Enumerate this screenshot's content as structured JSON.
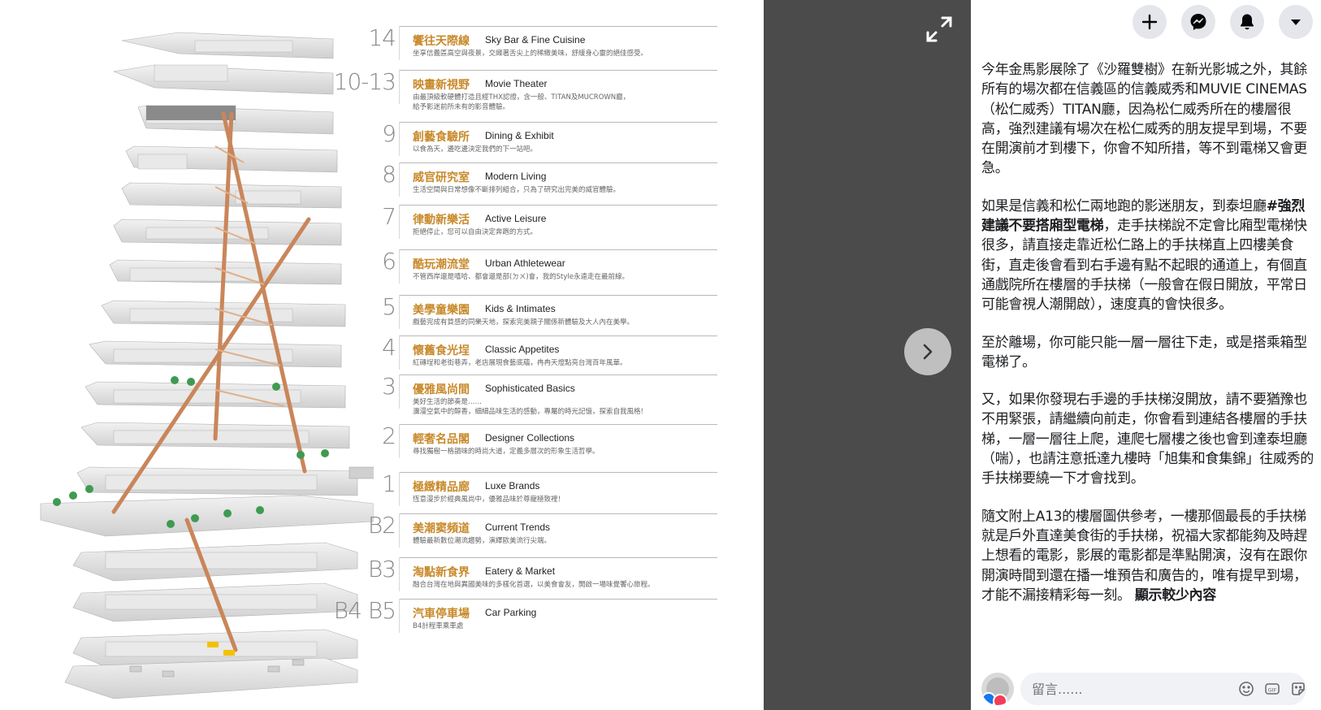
{
  "floors": [
    {
      "num": "14",
      "zh": "饗往天際線",
      "en": "Sky Bar & Fine Cuisine",
      "desc": "坐享信義區高空與夜景，交織著舌尖上的稀緻美味，舒緩身心靈的絕佳感受。"
    },
    {
      "num": "10-13",
      "zh": "映畫新視野",
      "en": "Movie Theater",
      "desc": "由最頂級軟硬體打造且經THX認證，含一般、TITAN及MUCROWN廳，\n給予影迷前所未有的影音體驗。"
    },
    {
      "num": "9",
      "zh": "創藝食驗所",
      "en": "Dining & Exhibit",
      "desc": "以食為天，邊吃邊決定我們的下一站吧。"
    },
    {
      "num": "8",
      "zh": "威官研究室",
      "en": "Modern Living",
      "desc": "生活空間與日常想像不斷排列組合，只為了研究出完美的威官體驗。"
    },
    {
      "num": "7",
      "zh": "律動新樂活",
      "en": "Active Leisure",
      "desc": "拒絕停止，您可以自由決定奔跑的方式。"
    },
    {
      "num": "6",
      "zh": "酷玩潮流堂",
      "en": "Urban Athletewear",
      "desc": "不管西岸還是嘻哈、都會還是部(ㄉㄨ)會，我的Style永遠走在最前線。"
    },
    {
      "num": "5",
      "zh": "美學童樂園",
      "en": "Kids & Intimates",
      "desc": "戲藝完成有質感的同樂天地，探索完美親子關係新體驗及大人內在美學。"
    },
    {
      "num": "4",
      "zh": "懷舊食光埕",
      "en": "Classic Appetites",
      "desc": "紅磚埕和老街巷弄，老店展現食藝底蘊，冉冉天燈點亮台灣百年風華。"
    },
    {
      "num": "3",
      "zh": "優雅風尚間",
      "en": "Sophisticated Basics",
      "desc": "美好生活的節奏是……\n瀰漫空氣中的醇香，細細品味生活的感動，專屬的時光記憶，探索自我風格!"
    },
    {
      "num": "2",
      "zh": "輕奢名品閣",
      "en": "Designer Collections",
      "desc": "尋找獨樹一格韻味的時尚大道，定義多層次的形象生活哲學。"
    },
    {
      "num": "1",
      "zh": "極緻精品廊",
      "en": "Luxe Brands",
      "desc": "恆意漫步於經典風尚中，優雅品味於尊寵極致裡！"
    },
    {
      "num": "B2",
      "zh": "美潮窦頻道",
      "en": "Current Trends",
      "desc": "體驗最新數位潮流趨勢，演繹歐美流行尖端。"
    },
    {
      "num": "B3",
      "zh": "淘點新食界",
      "en": "Eatery & Market",
      "desc": "融合台灣在地與異國美味的多樣化首選，以美食會友，開啟一場味覺饗心旅程。"
    },
    {
      "num": "B4 B5",
      "zh": "汽車停車場",
      "en": "Car Parking",
      "desc": "B4計程車乘車處"
    }
  ],
  "post": {
    "p1": "今年金馬影展除了《沙羅雙樹》在新光影城之外，其餘所有的場次都在信義區的信義威秀和MUVIE CINEMAS（松仁威秀）TITAN廳，因為松仁威秀所在的樓層很高，強烈建議有場次在松仁威秀的朋友提早到場，不要在開演前才到樓下，你會不知所措，等不到電梯又會更急。",
    "p2_a": "如果是信義和松仁兩地跑的影迷朋友，到泰坦廳",
    "p2_hashtag": "#強烈建議不要搭廂型電梯",
    "p2_b": "，走手扶梯說不定會比廂型電梯快很多，請直接走靠近松仁路上的手扶梯直上四樓美食街，直走後會看到右手邊有點不起眼的通道上，有個直通戲院所在樓層的手扶梯（一般會在假日開放，平常日可能會視人潮開啟），速度真的會快很多。",
    "p3": "至於離場，你可能只能一層一層往下走，或是搭乘箱型電梯了。",
    "p4": "又，如果你發現右手邊的手扶梯沒開放，請不要猶豫也不用緊張，請繼續向前走，你會看到連結各樓層的手扶梯，一層一層往上爬，連爬七層樓之後也會到達泰坦廳（喘），也請注意抵達九樓時「旭集和食集錦」往威秀的手扶梯要繞一下才會找到。",
    "p5": "隨文附上A13的樓層圖供參考，一樓那個最長的手扶梯就是戶外直達美食街的手扶梯，祝福大家都能夠及時趕上想看的電影，影展的電影都是準點開演，沒有在跟你開演時間到還在播一堆預告和廣告的，唯有提早到場，才能不漏接精彩每一刻。",
    "see_less": "顯示較少內容"
  },
  "comment": {
    "placeholder": "留言......"
  },
  "colors": {
    "floor_label": "#c8892a",
    "viewer_dark": "#4b4b4b"
  }
}
